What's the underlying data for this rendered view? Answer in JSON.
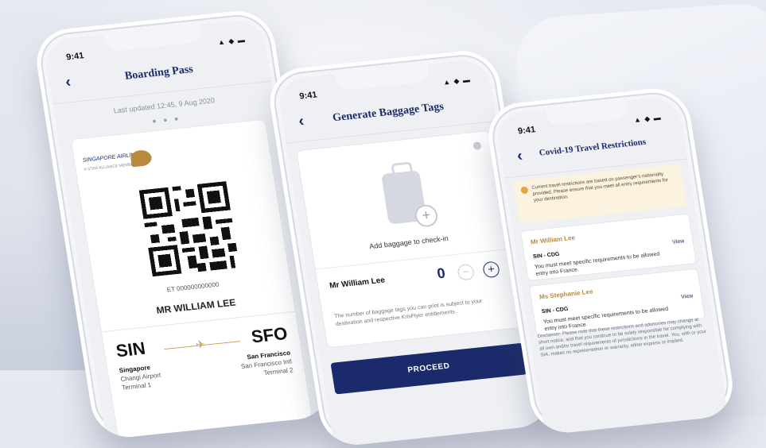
{
  "status_time": "9:41",
  "status_icons": "▲ ◆ ▬",
  "boarding_pass": {
    "title": "Boarding Pass",
    "last_updated": "Last updated 12:45, 9 Aug 2020",
    "page_dots": "● ● ●",
    "logo_text": "SINGAPORE AIRLINES",
    "logo_sub": "A STAR ALLIANCE MEMBER",
    "eticket": "ET 000000000000",
    "passenger_name": "MR WILLIAM LEE",
    "origin": {
      "code": "SIN",
      "city": "Singapore",
      "airport": "Changi Airport",
      "terminal": "Terminal 1"
    },
    "destination": {
      "code": "SFO",
      "city": "San Francisco",
      "airport": "San Francisco Intl",
      "terminal": "Terminal 2"
    }
  },
  "baggage": {
    "title": "Generate Baggage Tags",
    "add_text": "Add baggage to check-in",
    "passenger": "Mr William Lee",
    "count": "0",
    "note": "The number of baggage tags you can print is subject to your destination and respective KrisFlyer entitlements.",
    "proceed": "PROCEED"
  },
  "covid": {
    "title": "Covid-19 Travel Restrictions",
    "alert": "Current travel restrictions are based on passenger's nationality provided. Please ensure that you meet all entry requirements for your destination.",
    "passengers": [
      {
        "name": "Mr William Lee",
        "route": "SIN - CDG",
        "view": "View",
        "requirement": "You must meet specific requirements to be allowed entry into France."
      },
      {
        "name": "Ms Stephanie Lee",
        "route": "SIN - CDG",
        "view": "View",
        "requirement": "You must meet specific requirements to be allowed entry into France."
      }
    ],
    "disclaimer": "Disclaimer: Please note that these restrictions and advisories may change at short notice, and that you continue to be solely responsible for complying with all own and/or travel requirements of jurisdictions in the travel. You, with or your SIA, makes no representation or warranty, either express or implied."
  },
  "colors": {
    "navy": "#1b2a6b",
    "gold": "#b98a3b"
  }
}
